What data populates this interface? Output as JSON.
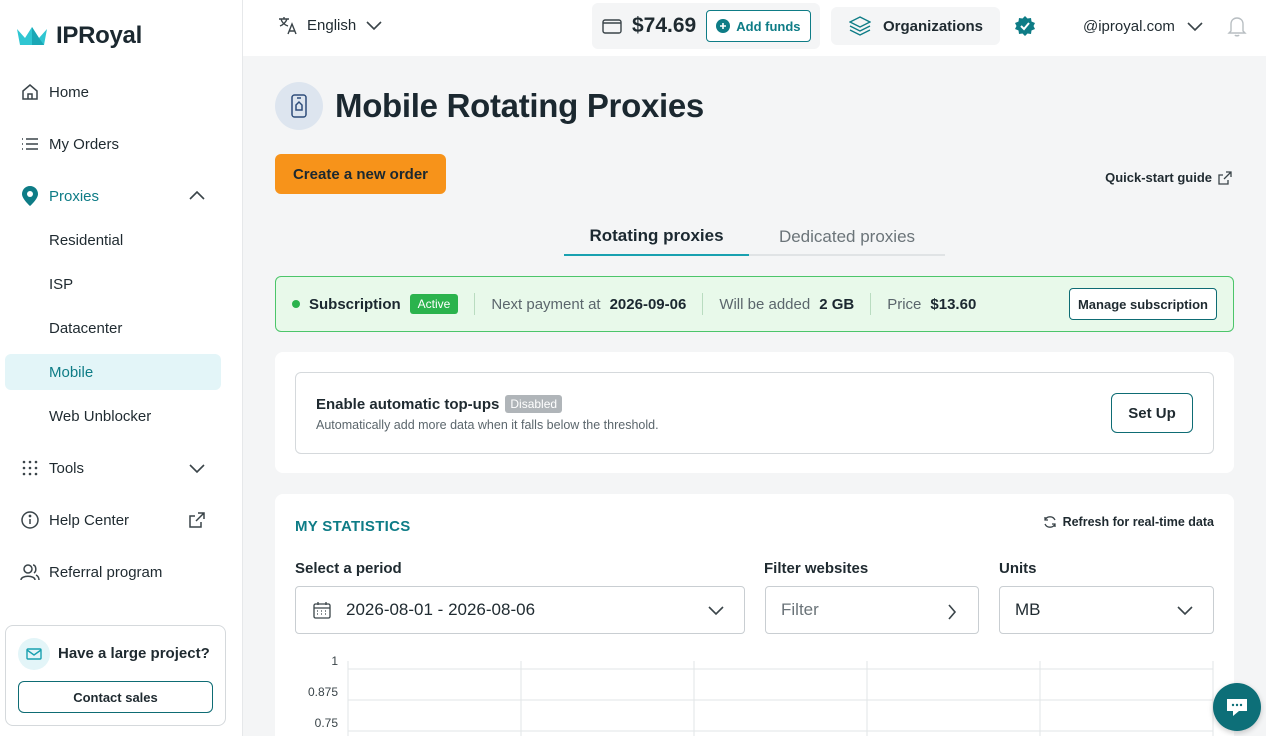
{
  "app": {
    "name": "IPRoyal"
  },
  "sidebar": {
    "items": [
      {
        "label": "Home",
        "icon": "home-icon"
      },
      {
        "label": "My Orders",
        "icon": "list-icon"
      },
      {
        "label": "Proxies",
        "icon": "location-pin-icon",
        "expanded": true
      },
      {
        "label": "Tools",
        "icon": "grid-dots-icon"
      },
      {
        "label": "Help Center",
        "icon": "info-icon"
      },
      {
        "label": "Referral program",
        "icon": "users-icon"
      }
    ],
    "proxy_sub_items": [
      "Residential",
      "ISP",
      "Datacenter",
      "Mobile",
      "Web Unblocker"
    ],
    "selected_sub_item": "Mobile",
    "project_card": {
      "title": "Have a large project?",
      "button": "Contact sales"
    }
  },
  "header": {
    "language": "English",
    "balance": "$74.69",
    "add_funds": "Add funds",
    "organizations": "Organizations",
    "account": "@iproyal.com"
  },
  "page": {
    "title": "Mobile Rotating Proxies",
    "create_button": "Create a new order",
    "quick_start": "Quick-start guide",
    "tabs": [
      {
        "label": "Rotating proxies",
        "active": true
      },
      {
        "label": "Dedicated proxies",
        "active": false
      }
    ]
  },
  "subscription": {
    "label": "Subscription",
    "status": "Active",
    "next_payment_label": "Next payment at",
    "next_payment": "2026-09-06",
    "added_label": "Will be added",
    "added": "2 GB",
    "price_label": "Price",
    "price": "$13.60",
    "manage": "Manage subscription"
  },
  "topup": {
    "title": "Enable automatic top-ups",
    "status": "Disabled",
    "description": "Automatically add more data when it falls below the threshold.",
    "button": "Set Up"
  },
  "statistics": {
    "title": "MY STATISTICS",
    "refresh": "Refresh for real-time data",
    "period_label": "Select a period",
    "period_value": "2026-08-01 - 2026-08-06",
    "filter_label": "Filter websites",
    "filter_placeholder": "Filter",
    "units_label": "Units",
    "units_value": "MB"
  },
  "chart_data": {
    "type": "line",
    "y_ticks": [
      "1",
      "0.875",
      "0.75"
    ],
    "ylim": [
      0,
      1
    ],
    "grid": true,
    "series": []
  },
  "colors": {
    "accent": "#0e7c86",
    "orange": "#f7931a",
    "active_green": "#2bb34d",
    "selected_bg": "#e3f5f8"
  }
}
